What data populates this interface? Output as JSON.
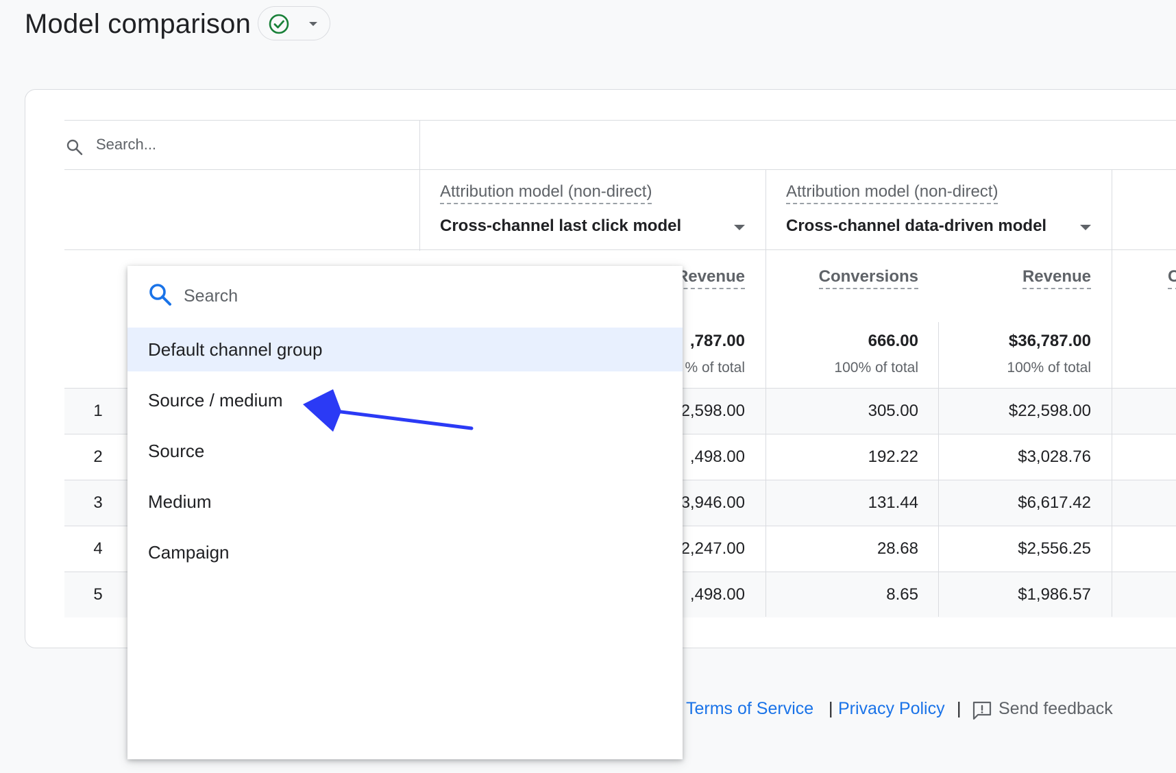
{
  "page": {
    "title": "Model comparison",
    "status_icon": "check-circle-icon"
  },
  "table": {
    "search_placeholder": "Search...",
    "models": [
      {
        "label": "Attribution model (non-direct)",
        "value": "Cross-channel last click model"
      },
      {
        "label": "Attribution model (non-direct)",
        "value": "Cross-channel data-driven model"
      }
    ],
    "columns": {
      "m1_revenue": "Revenue",
      "m2_conversions": "Conversions",
      "m2_revenue": "Revenue"
    },
    "totals": {
      "m1_revenue": ",787.00",
      "m1_revenue_pct": "% of total",
      "m2_conversions": "666.00",
      "m2_conversions_pct": "100% of total",
      "m2_revenue": "$36,787.00",
      "m2_revenue_pct": "100% of total"
    },
    "rows": [
      {
        "num": "1",
        "m1_revenue": "2,598.00",
        "m2_conversions": "305.00",
        "m2_revenue": "$22,598.00"
      },
      {
        "num": "2",
        "m1_revenue": ",498.00",
        "m2_conversions": "192.22",
        "m2_revenue": "$3,028.76"
      },
      {
        "num": "3",
        "m1_revenue": "3,946.00",
        "m2_conversions": "131.44",
        "m2_revenue": "$6,617.42"
      },
      {
        "num": "4",
        "m1_revenue": "2,247.00",
        "m2_conversions": "28.68",
        "m2_revenue": "$2,556.25"
      },
      {
        "num": "5",
        "m1_revenue": ",498.00",
        "m2_conversions": "8.65",
        "m2_revenue": "$1,986.57"
      }
    ],
    "next_column_partial": "C"
  },
  "dropdown": {
    "search_placeholder": "Search",
    "items": [
      {
        "label": "Default channel group",
        "selected": true
      },
      {
        "label": "Source / medium",
        "selected": false
      },
      {
        "label": "Source",
        "selected": false
      },
      {
        "label": "Medium",
        "selected": false
      },
      {
        "label": "Campaign",
        "selected": false
      }
    ]
  },
  "footer": {
    "terms": "Terms of Service",
    "privacy": "Privacy Policy",
    "separator": "|",
    "feedback": "Send feedback"
  },
  "colors": {
    "accent_blue": "#1a73e8",
    "success_green": "#188038",
    "annotation_arrow": "#2b3af5",
    "selected_bg": "#e8f0fe",
    "row_stripe": "#f8f9fa"
  }
}
